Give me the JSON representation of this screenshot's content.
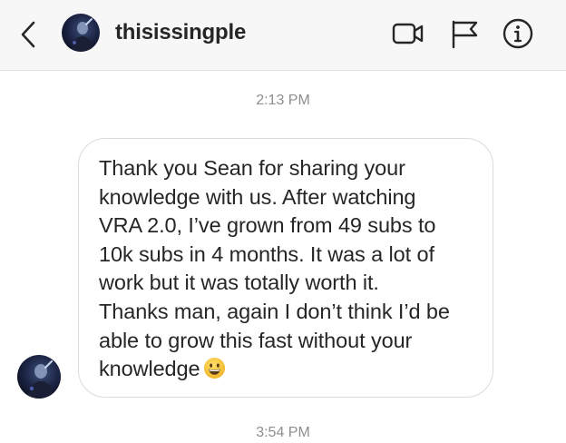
{
  "header": {
    "username": "thisissingple",
    "back_icon": "chevron-left-icon",
    "video_icon": "video-camera-icon",
    "flag_icon": "flag-icon",
    "info_icon": "info-icon"
  },
  "conversation": {
    "timestamps": [
      "2:13 PM",
      "3:54 PM"
    ],
    "message": {
      "text": "Thank you Sean for sharing your\nknowledge with us. After watching\nVRA 2.0, I’ve grown from 49 subs to\n10k subs in 4 months. It was a lot of\nwork but it was totally worth it.\nThanks man, again I don’t think I’d be\nable to grow this fast without your\nknowledge",
      "emoji": "grinning-face-icon"
    }
  },
  "colors": {
    "header_bg": "#f7f7f7",
    "text": "#262626",
    "timestamp": "#8e8e8e",
    "bubble_border": "#dbdbdb",
    "emoji_yellow": "#f7c93b"
  }
}
